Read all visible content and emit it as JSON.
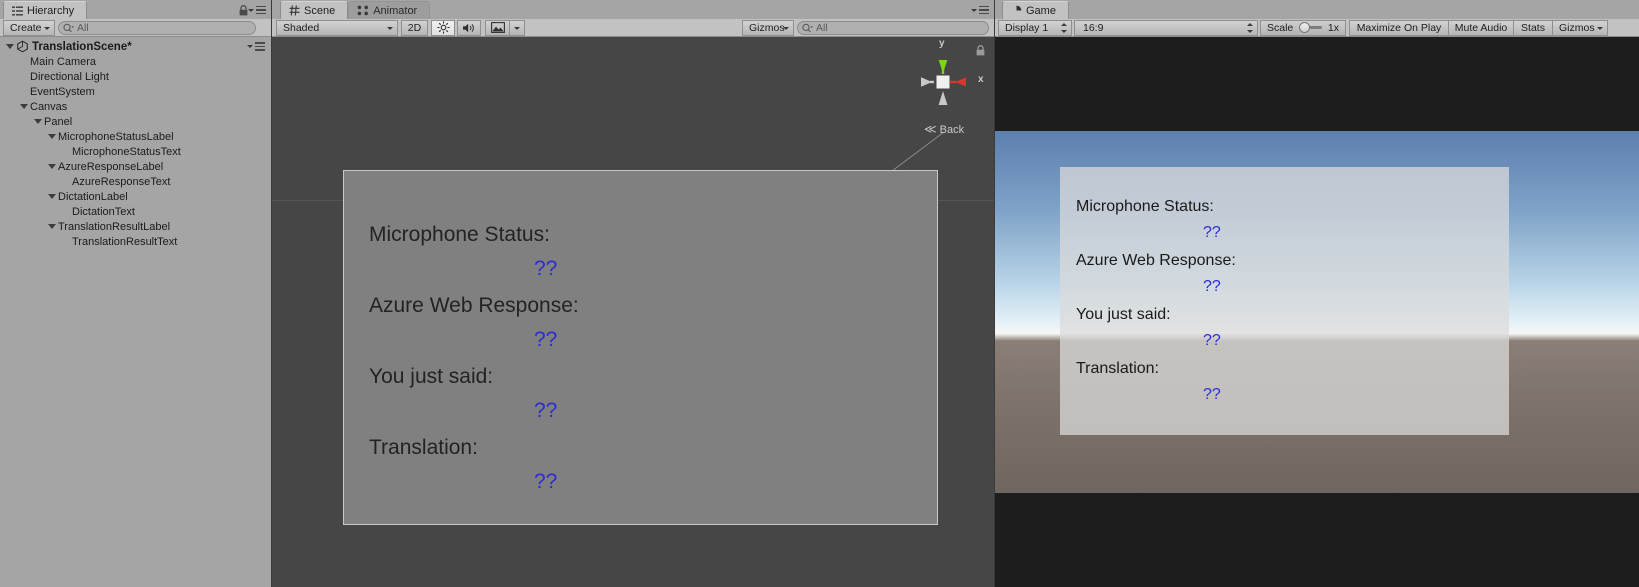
{
  "hierarchy": {
    "tab": {
      "label": "Hierarchy",
      "icon": "hierarchy-icon"
    },
    "toolbar": {
      "create_label": "Create",
      "search_placeholder": "All",
      "search_value": "All",
      "search_icon": "search-icon",
      "lock_icon": "lock-icon",
      "options_icon": "options-menu-icon"
    },
    "scene_root": {
      "label": "TranslationScene*",
      "icon": "unity-scene-icon",
      "expanded": true
    },
    "items": [
      {
        "label": "Main Camera",
        "depth": 1,
        "expandable": false
      },
      {
        "label": "Directional Light",
        "depth": 1,
        "expandable": false
      },
      {
        "label": "EventSystem",
        "depth": 1,
        "expandable": false
      },
      {
        "label": "Canvas",
        "depth": 1,
        "expandable": true
      },
      {
        "label": "Panel",
        "depth": 2,
        "expandable": true
      },
      {
        "label": "MicrophoneStatusLabel",
        "depth": 3,
        "expandable": true
      },
      {
        "label": "MicrophoneStatusText",
        "depth": 4,
        "expandable": false
      },
      {
        "label": "AzureResponseLabel",
        "depth": 3,
        "expandable": true
      },
      {
        "label": "AzureResponseText",
        "depth": 4,
        "expandable": false
      },
      {
        "label": "DictationLabel",
        "depth": 3,
        "expandable": true
      },
      {
        "label": "DictationText",
        "depth": 4,
        "expandable": false
      },
      {
        "label": "TranslationResultLabel",
        "depth": 3,
        "expandable": true
      },
      {
        "label": "TranslationResultText",
        "depth": 4,
        "expandable": false
      }
    ]
  },
  "scene": {
    "tabs": [
      {
        "label": "Scene",
        "icon": "scene-grid-icon",
        "active": true
      },
      {
        "label": "Animator",
        "icon": "animator-icon",
        "active": false
      }
    ],
    "toolbar": {
      "draw_mode": "Shaded",
      "mode_2d": "2D",
      "lighting_icon": "sun-lighting-icon",
      "audio_icon": "speaker-audio-icon",
      "effects_icon": "image-effects-icon",
      "gizmos_label": "Gizmos",
      "search_placeholder": "All",
      "search_value": "All",
      "search_icon": "search-icon",
      "options_icon": "options-menu-icon"
    },
    "gizmo": {
      "y_axis_label": "y",
      "x_axis_label": "x",
      "perspective_label": "Back",
      "y_color": "#7ed321",
      "x_color": "#e03131",
      "lock_icon": "lock-icon"
    },
    "object_gizmos": [
      {
        "name": "directional-light-gizmo",
        "icon": "sun-icon"
      },
      {
        "name": "main-camera-gizmo",
        "icon": "camera-icon"
      }
    ],
    "ui_rows": [
      {
        "label": "Microphone Status:",
        "value": "??"
      },
      {
        "label": "Azure Web Response:",
        "value": "??"
      },
      {
        "label": "You just said:",
        "value": "??"
      },
      {
        "label": "Translation:",
        "value": "??"
      }
    ]
  },
  "game": {
    "tab": {
      "label": "Game",
      "icon": "game-icon"
    },
    "toolbar": {
      "display": "Display 1",
      "aspect": "16:9",
      "scale_label": "Scale",
      "scale_value": "1x",
      "maximize_label": "Maximize On Play",
      "mute_label": "Mute Audio",
      "stats_label": "Stats",
      "gizmos_label": "Gizmos",
      "options_icon": "options-menu-icon"
    },
    "ui_rows": [
      {
        "label": "Microphone Status:",
        "value": "??"
      },
      {
        "label": "Azure Web Response:",
        "value": "??"
      },
      {
        "label": "You just said:",
        "value": "??"
      },
      {
        "label": "Translation:",
        "value": "??"
      }
    ]
  },
  "colors": {
    "chrome": "#a5a5a5",
    "toolbar": "#c2c2c2",
    "scene_bg": "#464646",
    "panel_gray": "#808080",
    "value_blue": "#2b2bd6",
    "axis_green": "#7ed321",
    "axis_red": "#e03131"
  }
}
